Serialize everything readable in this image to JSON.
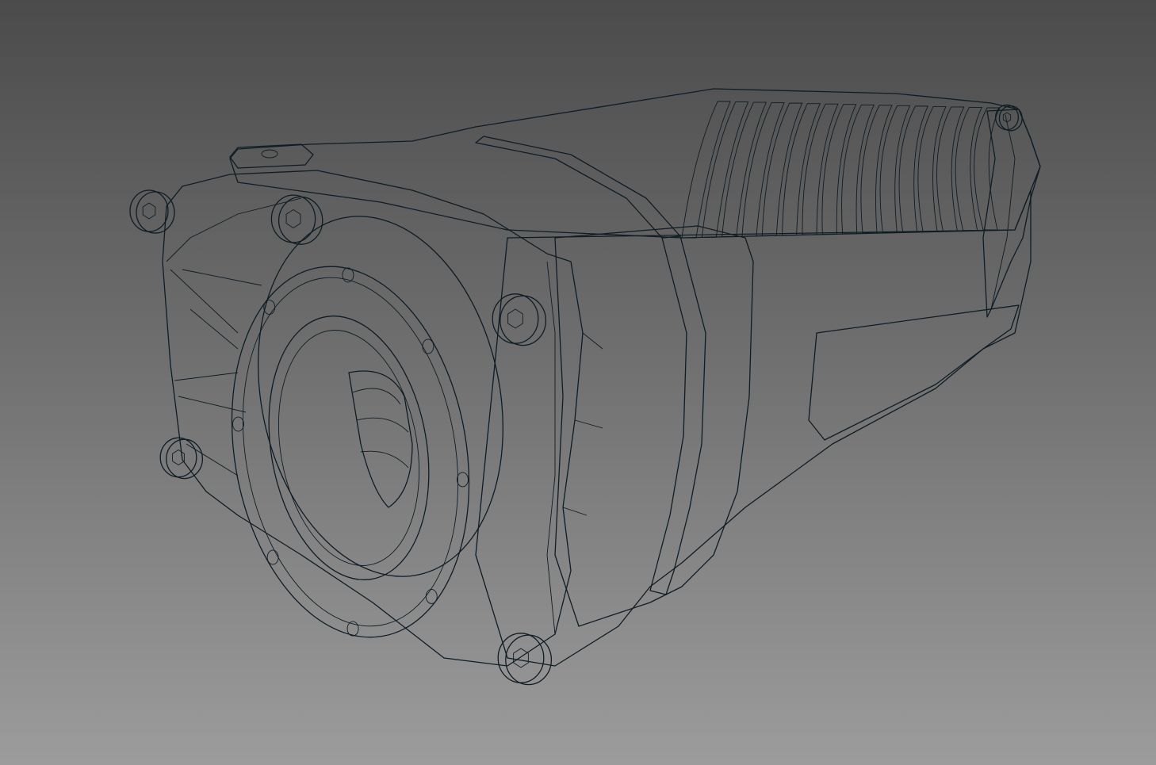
{
  "viewport": {
    "background_top": "#4b4b4b",
    "background_bottom": "#9c9c9c"
  },
  "model": {
    "body_color": "#3f7896",
    "body_highlight": "#8ec3dc",
    "body_shadow": "#1e3f52",
    "band_color": "#a9adb1",
    "bolt_color": "#b9bcbf",
    "edge_color": "#0f1c24",
    "bolt_count": 6,
    "flange_hole_count": 8,
    "rib_count": 16
  }
}
